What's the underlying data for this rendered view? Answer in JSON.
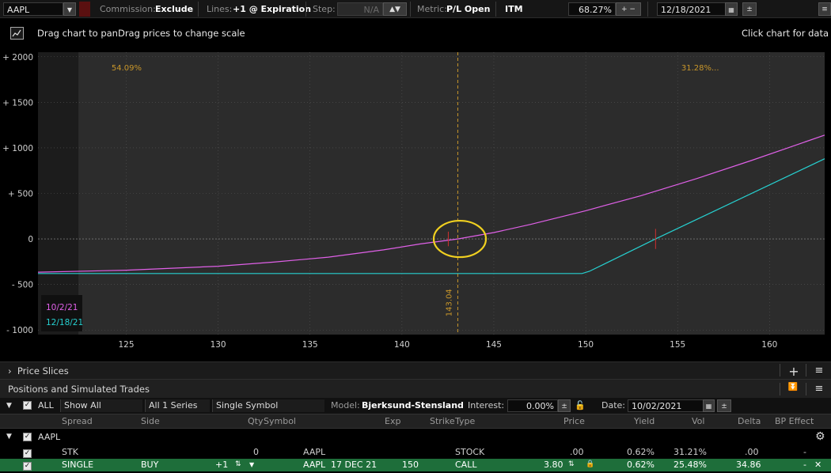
{
  "toolbar": {
    "symbol": "AAPL",
    "commission_label": "Commission:",
    "commission_value": "Exclude",
    "lines_label": "Lines:",
    "lines_value": "+1 @ Expiration",
    "step_label": "Step:",
    "step_value": "N/A",
    "metric_label": "Metric:",
    "metric_value": "P/L Open",
    "itm_value": "ITM",
    "itm_percent": "68.27%",
    "date_value": "12/18/2021"
  },
  "chart_header": {
    "hint": "Drag chart to panDrag prices to change scale",
    "data_hint": "Click chart for data"
  },
  "chart_data": {
    "type": "line",
    "x_ticks": [
      125,
      130,
      135,
      140,
      145,
      150,
      155,
      160
    ],
    "y_ticks": [
      "+ 2000",
      "+ 1500",
      "+ 1000",
      "+ 500",
      "0",
      "- 500",
      "- 1000"
    ],
    "xlim": [
      120.2,
      163
    ],
    "ylim": [
      -1050,
      2050
    ],
    "marker_price": 143.04,
    "marker_label": "143.04",
    "prob_left": "54.09%",
    "prob_right": "31.28%...",
    "shaded_until": 122.4,
    "series": [
      {
        "name": "10/2/21",
        "color": "#e060e8",
        "x": [
          120.2,
          125,
          130,
          133,
          136,
          139,
          141,
          143.04,
          145,
          147,
          150,
          153,
          156,
          159,
          161,
          163
        ],
        "y": [
          -365,
          -343,
          -300,
          -255,
          -200,
          -120,
          -55,
          0,
          70,
          160,
          310,
          475,
          660,
          860,
          1000,
          1140
        ]
      },
      {
        "name": "12/18/21",
        "color": "#26d0d0",
        "x": [
          120.2,
          149.8,
          150.2,
          153.8,
          163
        ],
        "y": [
          -380,
          -380,
          -355,
          0,
          880
        ]
      }
    ]
  },
  "panels": {
    "price_slices": "Price Slices",
    "positions": "Positions and Simulated Trades"
  },
  "filters": {
    "all_label": "ALL",
    "show": "Show All",
    "series": "All 1 Series",
    "symbol_mode": "Single Symbol",
    "model_label": "Model:",
    "model_value": "Bjerksund-Stensland",
    "interest_label": "Interest:",
    "interest_value": "0.00%",
    "date_label": "Date:",
    "date_value": "10/02/2021"
  },
  "columns": [
    "Spread",
    "Side",
    "Qty",
    "Symbol",
    "Exp",
    "Strike",
    "Type",
    "Price",
    "Yield",
    "Vol",
    "Delta",
    "BP Effect"
  ],
  "group": {
    "symbol": "AAPL"
  },
  "rows": [
    {
      "spread": "STK",
      "side": "",
      "qty": "0",
      "symbol": "AAPL",
      "exp": "",
      "strike": "",
      "type": "STOCK",
      "price": ".00",
      "yield": "0.62%",
      "vol": "31.21%",
      "delta": ".00",
      "bp": "-"
    },
    {
      "spread": "SINGLE",
      "side": "BUY",
      "qty": "+1",
      "symbol": "AAPL",
      "exp": "17 DEC 21",
      "strike": "150",
      "type": "CALL",
      "price": "3.80",
      "yield": "0.62%",
      "vol": "25.48%",
      "delta": "34.86",
      "bp": "-"
    }
  ],
  "colors": {
    "accent_green": "#1e6e3a",
    "highlight_circle": "#f0d020",
    "marker_line": "#c8962a"
  }
}
